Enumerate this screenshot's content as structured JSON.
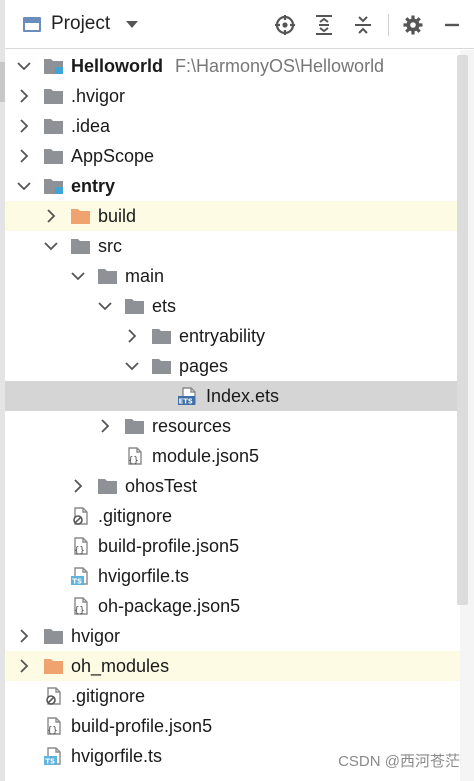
{
  "header": {
    "title": "Project",
    "icons": [
      "window-icon",
      "locate-crosshair-icon",
      "expand-all-icon",
      "collapse-all-icon",
      "gear-icon",
      "hide-minus-icon"
    ]
  },
  "tree": [
    {
      "label": "Helloworld",
      "path": "F:\\HarmonyOS\\Helloworld",
      "depth": 0,
      "expanded": true,
      "icon": "module-folder",
      "bold": true
    },
    {
      "label": ".hvigor",
      "depth": 0,
      "expanded": false,
      "icon": "folder"
    },
    {
      "label": ".idea",
      "depth": 0,
      "expanded": false,
      "icon": "folder"
    },
    {
      "label": "AppScope",
      "depth": 0,
      "expanded": false,
      "icon": "folder"
    },
    {
      "label": "entry",
      "depth": 0,
      "expanded": true,
      "icon": "module-folder",
      "bold": true
    },
    {
      "label": "build",
      "depth": 1,
      "expanded": false,
      "icon": "folder-orange",
      "highlight": "yellow"
    },
    {
      "label": "src",
      "depth": 1,
      "expanded": true,
      "icon": "folder"
    },
    {
      "label": "main",
      "depth": 2,
      "expanded": true,
      "icon": "folder"
    },
    {
      "label": "ets",
      "depth": 3,
      "expanded": true,
      "icon": "folder"
    },
    {
      "label": "entryability",
      "depth": 4,
      "expanded": false,
      "icon": "folder"
    },
    {
      "label": "pages",
      "depth": 4,
      "expanded": true,
      "icon": "folder"
    },
    {
      "label": "Index.ets",
      "depth": 5,
      "leaf": true,
      "icon": "ets-file",
      "selected": true
    },
    {
      "label": "resources",
      "depth": 3,
      "expanded": false,
      "icon": "folder"
    },
    {
      "label": "module.json5",
      "depth": 3,
      "leaf": true,
      "icon": "json-file"
    },
    {
      "label": "ohosTest",
      "depth": 2,
      "expanded": false,
      "icon": "folder"
    },
    {
      "label": ".gitignore",
      "depth": 1,
      "leaf": true,
      "icon": "gitignore-file"
    },
    {
      "label": "build-profile.json5",
      "depth": 1,
      "leaf": true,
      "icon": "json-file"
    },
    {
      "label": "hvigorfile.ts",
      "depth": 1,
      "leaf": true,
      "icon": "ts-file"
    },
    {
      "label": "oh-package.json5",
      "depth": 1,
      "leaf": true,
      "icon": "json-file"
    },
    {
      "label": "hvigor",
      "depth": 0,
      "expanded": false,
      "icon": "folder"
    },
    {
      "label": "oh_modules",
      "depth": 0,
      "expanded": false,
      "icon": "folder-orange",
      "highlight": "yellow"
    },
    {
      "label": ".gitignore",
      "depth": 0,
      "leaf": true,
      "icon": "gitignore-file"
    },
    {
      "label": "build-profile.json5",
      "depth": 0,
      "leaf": true,
      "icon": "json-file"
    },
    {
      "label": "hvigorfile.ts",
      "depth": 0,
      "leaf": true,
      "icon": "ts-file"
    }
  ],
  "watermark": "CSDN @西河苍茫",
  "colors": {
    "folder": "#8e9296",
    "folder_orange": "#f0a36f",
    "module_badge": "#3ca4d6",
    "ts_badge": "#5fb4df",
    "ets_badge": "#3f6fa8",
    "selection": "#d5d5d5",
    "excluded_highlight": "#fdfbe3"
  }
}
